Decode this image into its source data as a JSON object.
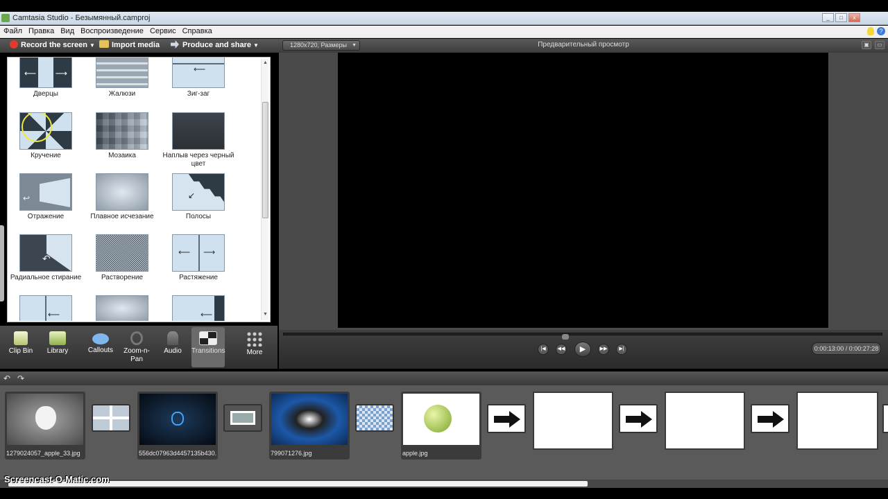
{
  "window": {
    "title": "Camtasia Studio - Безымянный.camproj"
  },
  "menu": [
    "Файл",
    "Правка",
    "Вид",
    "Воспроизведение",
    "Сервис",
    "Справка"
  ],
  "toolbar": {
    "record": "Record the screen",
    "import": "Import media",
    "produce": "Produce and share"
  },
  "transitions": [
    {
      "label": "Дверцы",
      "icon": "doors-icon"
    },
    {
      "label": "Жалюзи",
      "icon": "blinds-icon"
    },
    {
      "label": "Зиг-заг",
      "icon": "zigzag-icon"
    },
    {
      "label": "Кручение",
      "icon": "spin-icon"
    },
    {
      "label": "Мозаика",
      "icon": "mosaic-icon"
    },
    {
      "label": "Наплыв через черный цвет",
      "icon": "fade-black-icon"
    },
    {
      "label": "Отражение",
      "icon": "reflection-icon"
    },
    {
      "label": "Плавное исчезание",
      "icon": "smooth-fade-icon"
    },
    {
      "label": "Полосы",
      "icon": "stripes-icon"
    },
    {
      "label": "Радиальное стирание",
      "icon": "radial-wipe-icon"
    },
    {
      "label": "Растворение",
      "icon": "dissolve-icon"
    },
    {
      "label": "Растяжение",
      "icon": "stretch-icon"
    }
  ],
  "tabs": [
    {
      "label": "Clip Bin"
    },
    {
      "label": "Library"
    },
    {
      "label": "Callouts"
    },
    {
      "label": "Zoom-n-Pan"
    },
    {
      "label": "Audio"
    },
    {
      "label": "Transitions"
    },
    {
      "label": "More"
    }
  ],
  "preview": {
    "dims": "1280x720, Размеры",
    "title": "Предварительный просмотр",
    "time": "0:00:13:00 / 0:00:27:28"
  },
  "clips": [
    {
      "caption": "1279024057_apple_33.jpg"
    },
    {
      "caption": "556dc07963d4457135b430..."
    },
    {
      "caption": "799071276.jpg"
    },
    {
      "caption": "apple.jpg"
    }
  ],
  "watermark": "Screencast-O-Matic.com"
}
